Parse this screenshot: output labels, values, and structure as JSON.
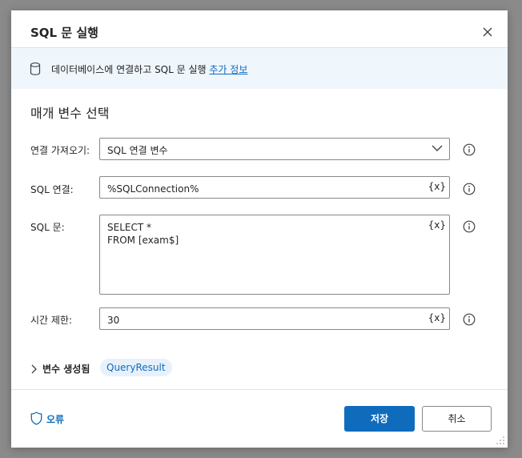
{
  "dialog": {
    "title": "SQL 문 실행",
    "close_icon": "close-icon"
  },
  "info": {
    "icon": "database-icon",
    "text": "데이터베이스에 연결하고 SQL 문 실행 ",
    "link": "추가 정보"
  },
  "section_title": "매개 변수 선택",
  "fields": {
    "connection_source": {
      "label": "연결 가져오기:",
      "value": "SQL 연결 변수"
    },
    "sql_connection": {
      "label": "SQL 연결:",
      "value": "%SQLConnection%",
      "var_button": "{x}"
    },
    "sql_statement": {
      "label": "SQL 문:",
      "value": "SELECT *\nFROM [exam$]",
      "var_button": "{x}"
    },
    "timeout": {
      "label": "시간 제한:",
      "value": "30",
      "var_button": "{x}"
    }
  },
  "variables": {
    "label": "변수 생성됨",
    "badge": "QueryResult"
  },
  "footer": {
    "error_label": "오류",
    "save_label": "저장",
    "cancel_label": "취소"
  },
  "colors": {
    "accent": "#0f6cbd",
    "info_bar": "#eff6fc",
    "badge_bg": "#e8f1fb"
  }
}
